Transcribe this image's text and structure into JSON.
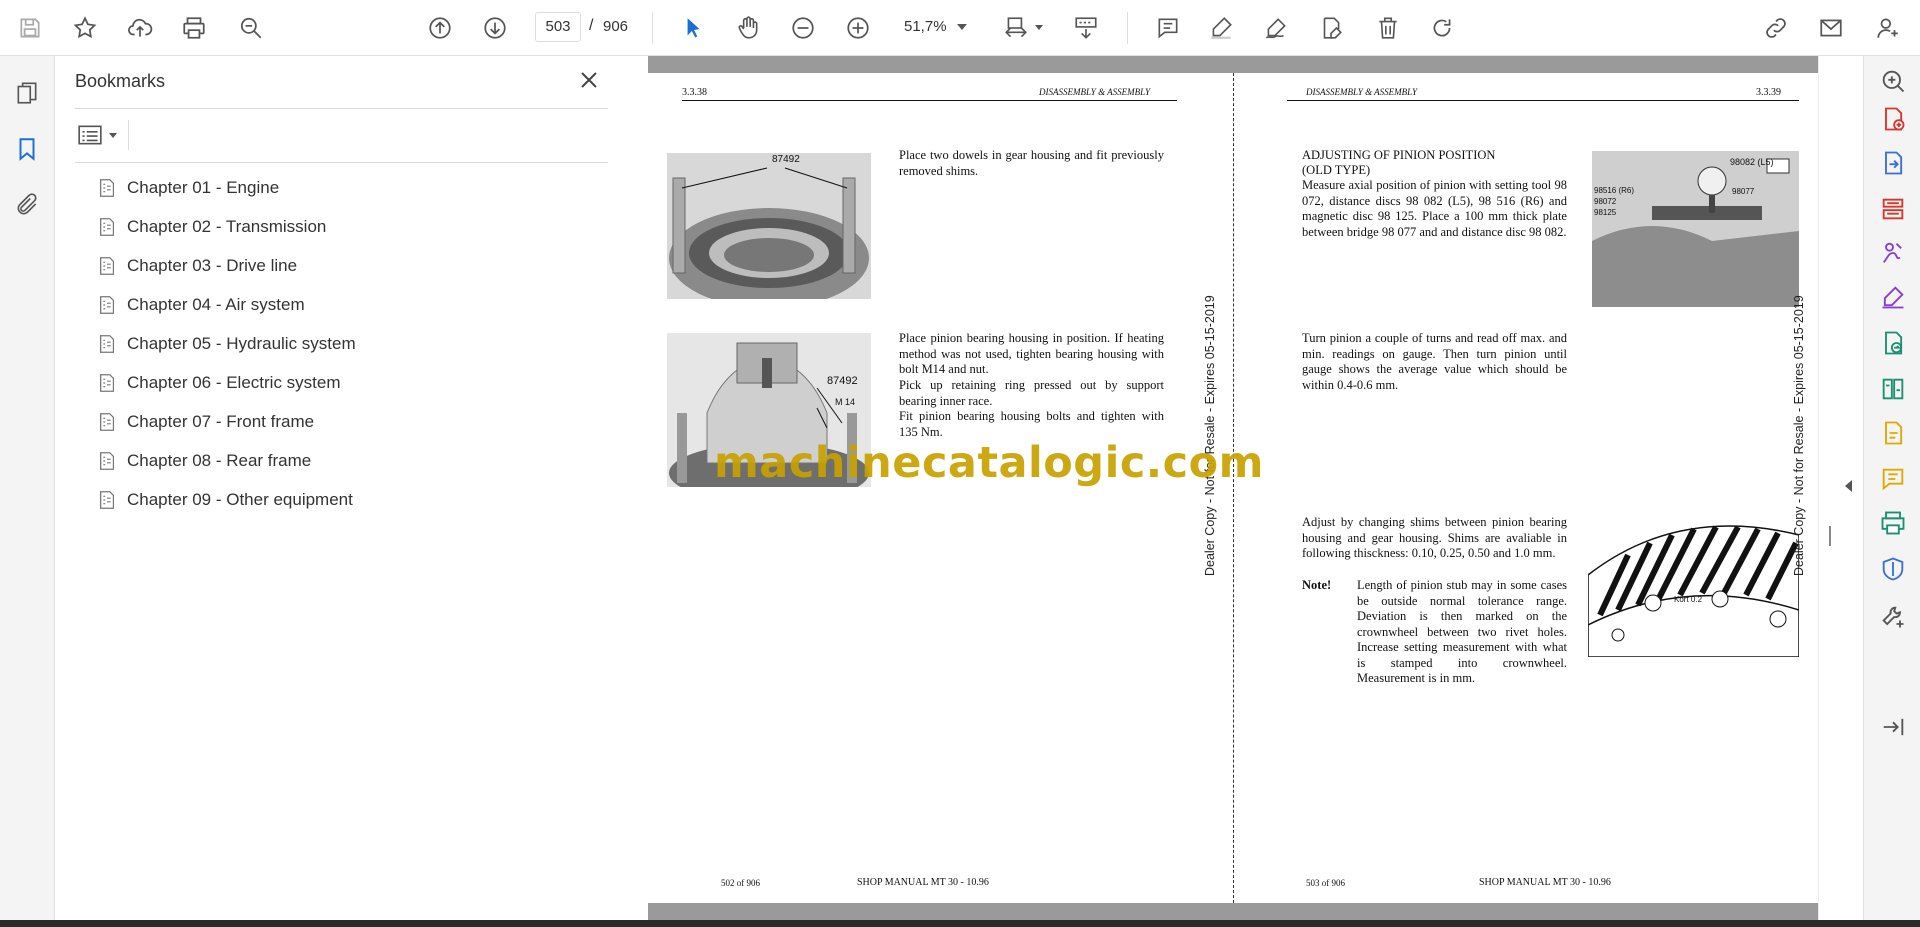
{
  "toolbar": {
    "page_current": "503",
    "page_separator": "/",
    "page_total": "906",
    "zoom": "51,7%",
    "icons": [
      "save-icon",
      "bookmark-star-icon",
      "upload-icon",
      "print-icon",
      "find-icon",
      "page-up-icon",
      "page-down-icon",
      "select-arrow-icon",
      "hand-icon",
      "zoom-out-icon",
      "zoom-in-icon",
      "page-fit-icon",
      "scroll-mode-icon",
      "comment-icon",
      "highlight-icon",
      "draw-icon",
      "fill-sign-icon",
      "delete-icon",
      "rotate-icon",
      "share-link-icon",
      "email-icon",
      "account-icon"
    ]
  },
  "left_rail": {
    "icons": [
      "pages-icon",
      "bookmarks-icon",
      "attachments-icon"
    ]
  },
  "bookmarks": {
    "title": "Bookmarks",
    "items": [
      {
        "label": "Chapter 01 - Engine"
      },
      {
        "label": "Chapter 02 - Transmission"
      },
      {
        "label": "Chapter 03 - Drive line"
      },
      {
        "label": "Chapter 04 - Air system"
      },
      {
        "label": "Chapter 05 - Hydraulic system"
      },
      {
        "label": "Chapter 06 - Electric system"
      },
      {
        "label": "Chapter 07 - Front frame"
      },
      {
        "label": "Chapter 08 - Rear frame"
      },
      {
        "label": "Chapter 09 - Other equipment"
      }
    ]
  },
  "left_page": {
    "page_no": "3.3.38",
    "section": "DISASSEMBLY & ASSEMBLY",
    "para1": "Place two dowels in gear housing and fit previously removed shims.",
    "para2": "Place pinion bearing housing in position. If heating method was not used, tighten bearing housing with bolt M14  and nut.",
    "para3": "Pick up retaining ring pressed out by support bearing inner race.",
    "para4": "Fit pinion bearing housing bolts and tighten with 135 Nm.",
    "photo1_label": "87492",
    "photo2_label1": "87492",
    "photo2_label2": "M 14",
    "footer_left": "502 of 906",
    "footer_center": "SHOP MANUAL MT 30 - 10.96"
  },
  "right_page": {
    "page_no": "3.3.39",
    "section": "DISASSEMBLY & ASSEMBLY",
    "heading1": "ADJUSTING OF PINION POSITION",
    "heading2": "(OLD TYPE)",
    "para1": "Measure axial position of pinion with setting tool 98 072, distance discs 98 082 (L5), 98 516 (R6) and magnetic disc 98 125. Place a 100 mm thick plate between bridge 98 077 and and distance disc 98 082.",
    "para2": "Turn pinion a couple of turns and read off max. and min. readings on gauge. Then turn pinion until gauge shows the average value which should be within 0.4-0.6 mm.",
    "para3": "Adjust by changing shims between pinion bearing housing and gear housing. Shims are avaliable in following thisckness: 0.10, 0.25, 0.50 and 1.0 mm.",
    "note_label": "Note!",
    "note_text": "Length of pinion stub may in some cases be outside normal tolerance range. Deviation is then marked on the crownwheel between two rivet holes. Increase setting measurement with what is stamped into crownwheel. Measurement is in mm.",
    "photo_labels": [
      "98082 (L5)",
      "98516 (R6)",
      "98072",
      "98125",
      "98077"
    ],
    "gear_label": "Kort 0.2",
    "footer_left": "503 of 906",
    "footer_center": "SHOP MANUAL MT 30 - 10.96"
  },
  "watermark": "machinecatalogic.com",
  "dealer_stamp": "Dealer Copy - Not for Resale - Expires 05-15-2019",
  "right_rail": {
    "icons": [
      "zoom-tool-icon",
      "create-pdf-icon",
      "export-pdf-icon",
      "organize-pages-icon",
      "sign-icon",
      "fill-sign-tool-icon",
      "send-for-review-icon",
      "compare-icon",
      "edit-pdf-icon",
      "comment-tool-icon",
      "print-production-icon",
      "protect-icon",
      "more-tools-icon",
      "expand-panel-icon"
    ],
    "colors": [
      "#555555",
      "#d8352a",
      "#3b6fd6",
      "#d8352a",
      "#8b3bd6",
      "#8b3bd6",
      "#1b8f6f",
      "#1b8f6f",
      "#e0a800",
      "#e0a800",
      "#1b8f6f",
      "#3b6fd6",
      "#555555",
      "#555555"
    ]
  }
}
